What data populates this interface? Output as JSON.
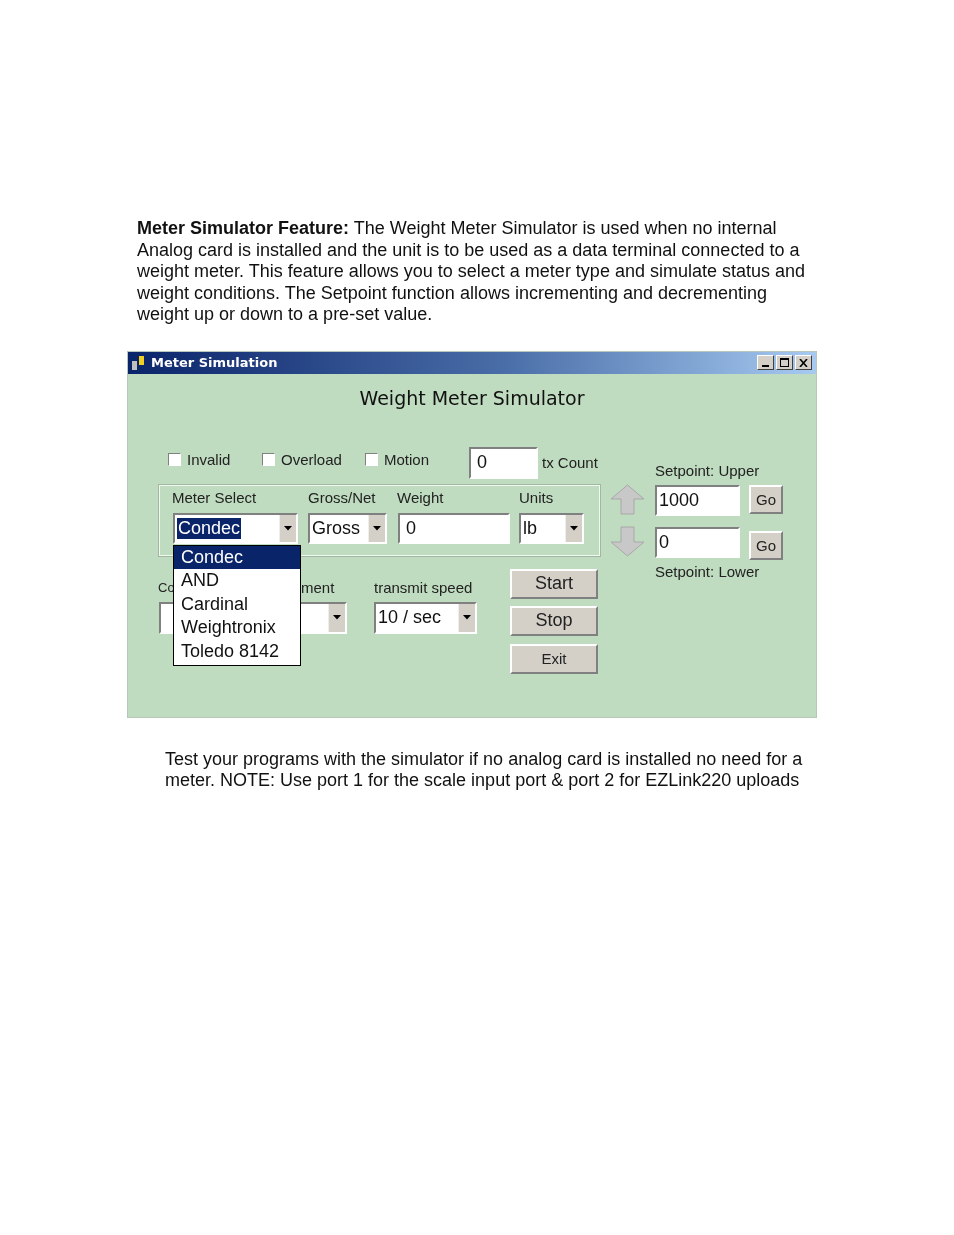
{
  "intro": "**Meter Simulator Feature:** The Weight Meter Simulator is used when no internal Analog card is installed and the unit is to be used as a data terminal connected to a weight meter. This feature allows you to select a meter type and simulate status and weight conditions. The Setpoint function allows incrementing and decrementing weight up or down to a pre-set value.",
  "window": {
    "title": "Meter Simulation",
    "heading": "Weight Meter Simulator",
    "checkboxes": [
      {
        "label": "Invalid",
        "checked": false
      },
      {
        "label": "Overload",
        "checked": false
      },
      {
        "label": "Motion",
        "checked": false
      }
    ],
    "tx_count": {
      "value": "0",
      "label": "tx Count"
    },
    "meter_group": {
      "fields": [
        {
          "kind": "combo",
          "label": "Meter Select",
          "value": "Condec",
          "highlighted": true
        },
        {
          "kind": "combo",
          "label": "Gross/Net",
          "value": "Gross",
          "highlighted": false
        },
        {
          "kind": "text",
          "label": "Weight",
          "value": "0"
        },
        {
          "kind": "combo",
          "label": "Units",
          "value": "lb",
          "highlighted": false
        }
      ]
    },
    "setpoint_upper": {
      "label": "Setpoint: Upper",
      "value": "1000",
      "button": "Go"
    },
    "setpoint_lower": {
      "label": "Setpoint: Lower",
      "value": "0",
      "button": "Go"
    },
    "lower_row": {
      "label_1": "Co",
      "label_2": "ment",
      "transmit_label": "transmit speed",
      "transmit_value": "10 / sec"
    },
    "buttons": [
      "Start",
      "Stop",
      "Exit"
    ],
    "dropdown": [
      {
        "label": "Condec",
        "selected": true
      },
      {
        "label": "AND",
        "selected": false
      },
      {
        "label": "Cardinal",
        "selected": false
      },
      {
        "label": "Weightronix",
        "selected": false
      },
      {
        "label": "Toledo 8142",
        "selected": false
      }
    ]
  },
  "note": "Test your programs with the simulator if no analog card is installed no need for a meter. NOTE: Use port 1 for the scale input port & port 2 for EZLink220 uploads"
}
